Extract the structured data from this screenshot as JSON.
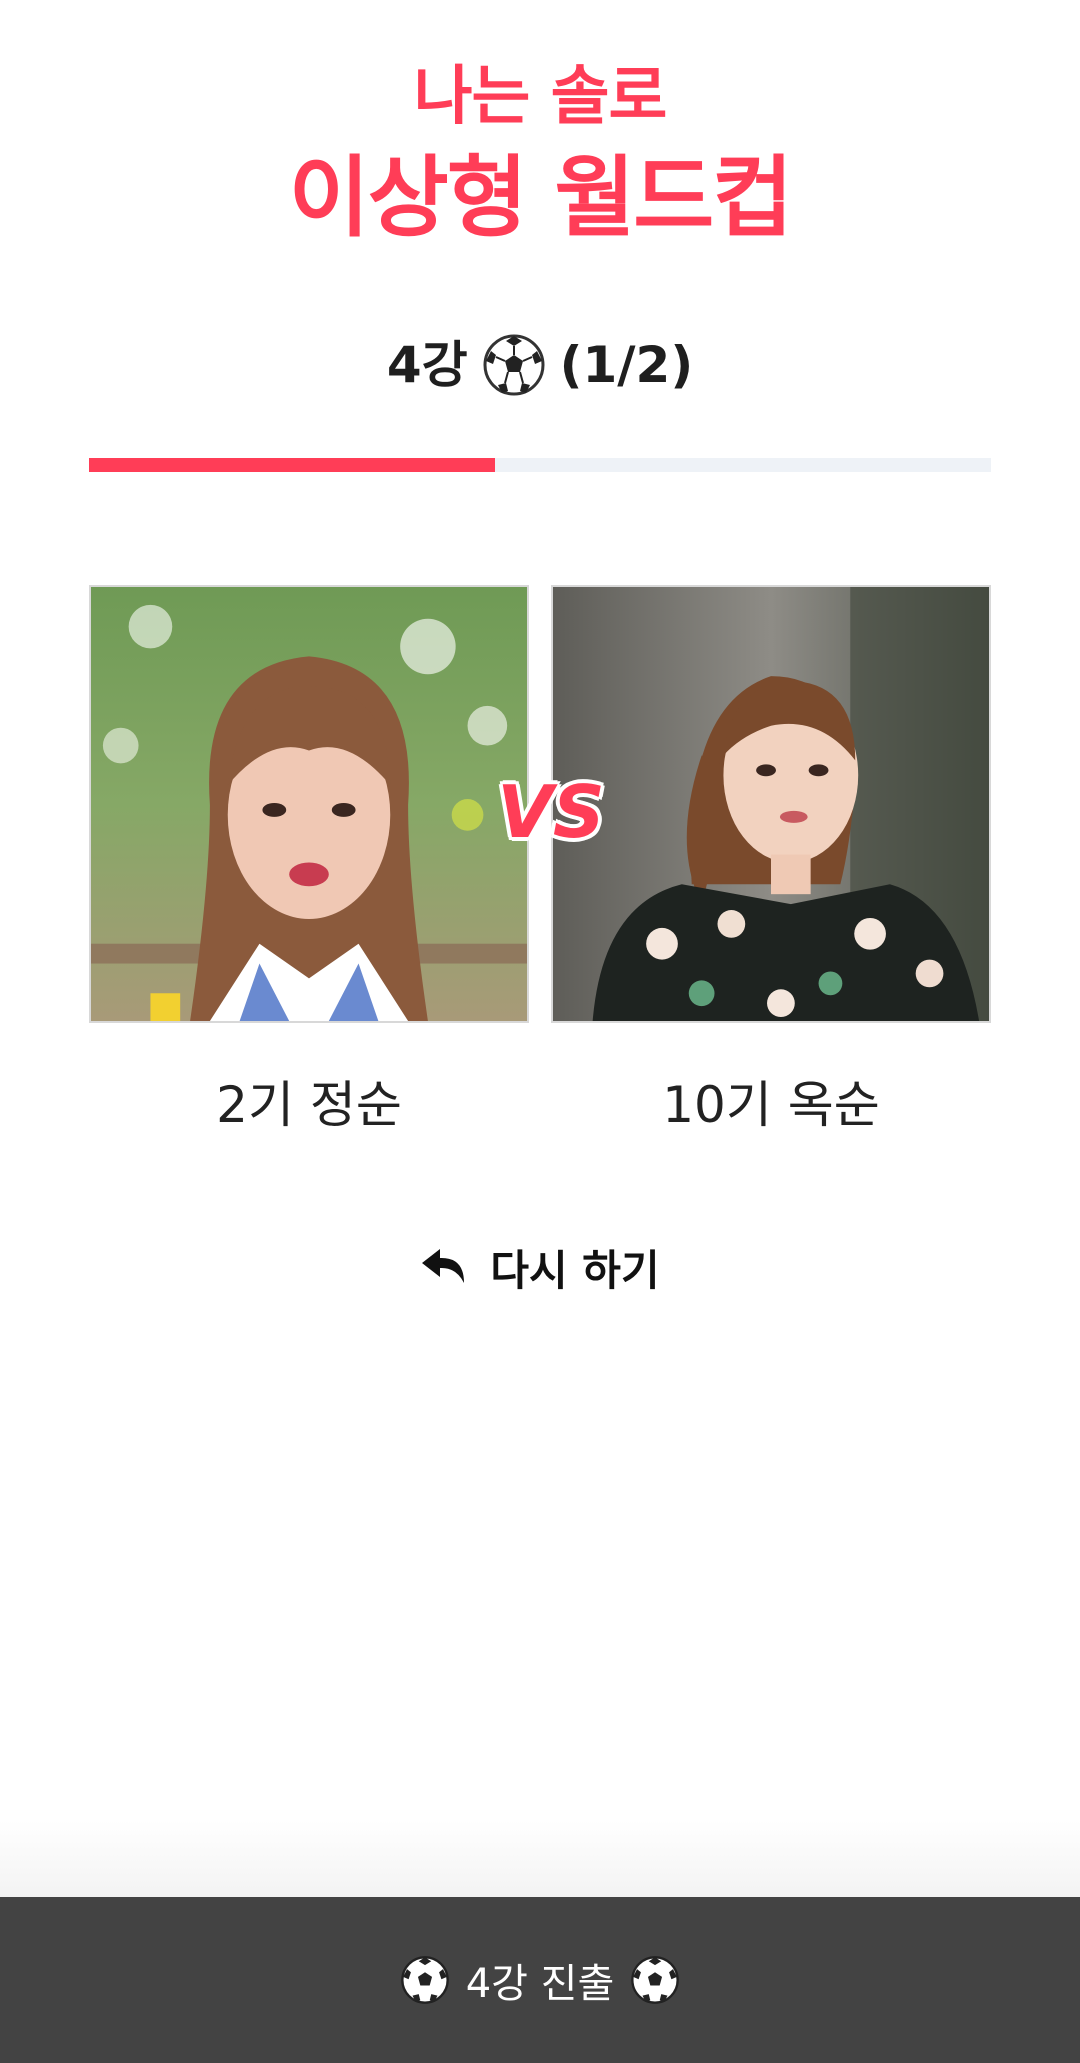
{
  "header": {
    "title_small": "나는 솔로",
    "title_big": "이상형 월드컵"
  },
  "round": {
    "label_prefix": "4강",
    "icon": "soccer-ball-icon",
    "progress_text": "(1/2)",
    "progress_fraction": 0.45
  },
  "match": {
    "vs_label": "VS",
    "left": {
      "name": "2기 정순",
      "photo": "portrait-woman-bob-hair"
    },
    "right": {
      "name": "10기 옥순",
      "photo": "portrait-woman-floral-dress"
    }
  },
  "actions": {
    "retry_label": "다시 하기",
    "retry_icon": "reply-arrow-icon"
  },
  "footer": {
    "label": "4강 진출"
  },
  "colors": {
    "accent": "#ff3d57",
    "progress_track": "#eef2f7",
    "footer_bg": "#434343"
  }
}
